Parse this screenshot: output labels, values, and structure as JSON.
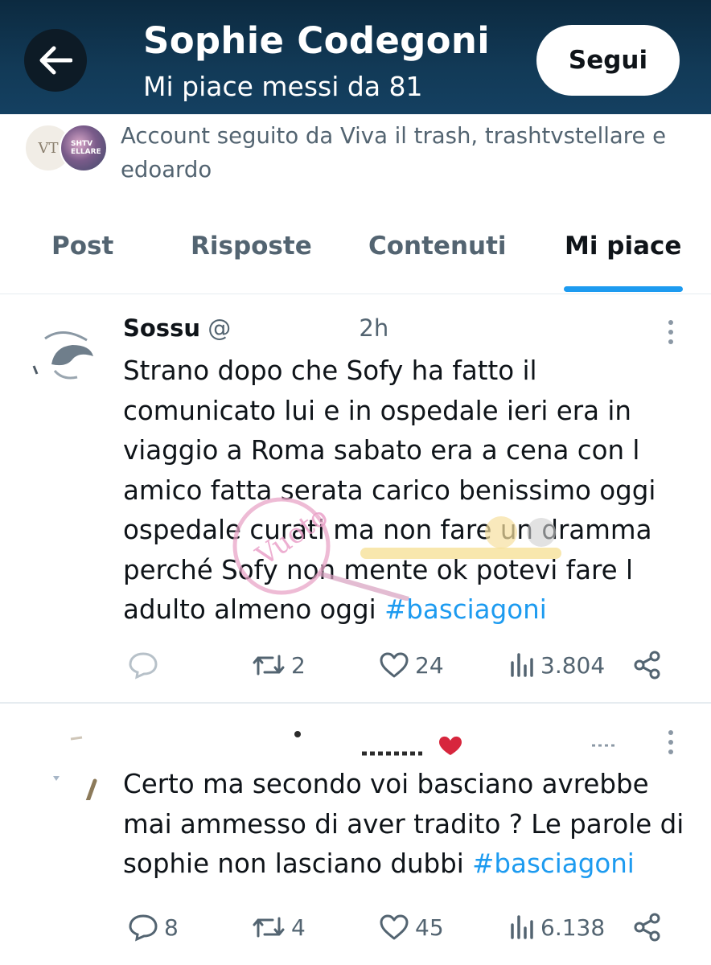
{
  "header": {
    "title": "Sophie Codegoni",
    "subtitle": "Mi piace messi da 81",
    "follow_label": "Segui"
  },
  "followed_by": {
    "text": "Account seguito da Viva il trash, trashtvstellare e edoardo",
    "avatar1_label": "VT",
    "avatar2_label": "SHTV ELLARE"
  },
  "tabs": [
    {
      "label": "Post",
      "active": false
    },
    {
      "label": "Risposte",
      "active": false
    },
    {
      "label": "Contenuti",
      "active": false
    },
    {
      "label": "Mi piace",
      "active": true
    }
  ],
  "tweets": [
    {
      "author_visible": "Sossu",
      "handle_visible": "@",
      "time": "2h",
      "text": "Strano dopo che Sofy ha fatto il comunicato lui e in ospedale ieri era in viaggio a Roma sabato era a cena con l amico fatta serata carico benissimo oggi ospedale curati ma non fare un dramma perché Sofy non mente ok potevi fare l adulto almeno oggi ",
      "hashtag": "#basciagoni",
      "replies": "",
      "reposts": "2",
      "likes": "24",
      "views": "3.804"
    },
    {
      "text": "Certo ma secondo voi basciano avrebbe mai ammesso di aver tradito ? Le parole di sophie non lasciano dubbi ",
      "hashtag": "#basciagoni",
      "replies": "8",
      "reposts": "4",
      "likes": "45",
      "views": "6.138"
    }
  ],
  "colors": {
    "header_bg": "#123a57",
    "accent": "#1d9bf0",
    "text_secondary": "#536471"
  }
}
